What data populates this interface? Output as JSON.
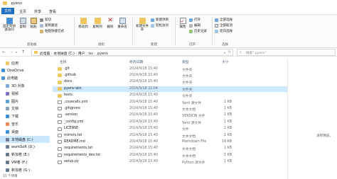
{
  "window": {
    "title": ".pyenv"
  },
  "ribbon": {
    "tabs": [
      "文件",
      "主页",
      "共享",
      "查看"
    ],
    "clipboard": {
      "pin": "固定到快速访问",
      "copy": "复制",
      "paste": "粘贴",
      "cut": "剪切",
      "copy_path": "复制路径",
      "paste_shortcut": "粘贴快捷方式",
      "label": "剪贴板"
    },
    "organize": {
      "move_to": "移动到",
      "copy_to": "复制到",
      "delete": "删除",
      "rename": "重命名",
      "label": "组织"
    },
    "new": {
      "new_folder": "新建文件夹",
      "new_item": "新建项目",
      "easy_access": "轻松访问",
      "label": "新建"
    },
    "open": {
      "properties": "属性",
      "open": "打开",
      "edit": "编辑",
      "history": "历史记录",
      "label": "打开"
    },
    "select": {
      "select_all": "全部选择",
      "select_none": "全部取消",
      "invert": "反向选择",
      "label": "选择"
    }
  },
  "address": {
    "path": [
      "此电脑",
      "本地磁盘 (C:)",
      "用户",
      "lss",
      ".pyenv"
    ],
    "search_placeholder": "搜索\".pyenv\""
  },
  "nav": [
    {
      "label": "应用"
    },
    {
      "label": "OneDrive"
    },
    {
      "label": "此电脑"
    },
    {
      "label": "3D 对象"
    },
    {
      "label": "视频"
    },
    {
      "label": "图片"
    },
    {
      "label": "文档"
    },
    {
      "label": "下载"
    },
    {
      "label": "音乐"
    },
    {
      "label": "桌面"
    },
    {
      "label": "本地磁盘 (C:)"
    },
    {
      "label": "workSoft (D:)"
    },
    {
      "label": "新加卷 (E:)"
    },
    {
      "label": "VM卷 (F:)"
    },
    {
      "label": "新加卷 (G:)"
    }
  ],
  "columns": {
    "name": "名称",
    "date": "修改日期",
    "type": "类型",
    "size": "大小"
  },
  "files": [
    {
      "name": ".git",
      "date": "2024/9/18 15:40",
      "type": "文件夹",
      "size": "",
      "kind": "folder"
    },
    {
      "name": ".github",
      "date": "2024/9/18 15:40",
      "type": "文件夹",
      "size": "",
      "kind": "folder"
    },
    {
      "name": "docs",
      "date": "2024/9/18 15:40",
      "type": "文件夹",
      "size": "",
      "kind": "folder"
    },
    {
      "name": "pyenv-win",
      "date": "2024/9/18 21:04",
      "type": "文件夹",
      "size": "",
      "kind": "folder",
      "selected": true
    },
    {
      "name": "tests",
      "date": "2024/9/18 15:40",
      "type": "文件夹",
      "size": "",
      "kind": "folder"
    },
    {
      "name": ".coveralls.yml",
      "date": "2024/9/18 15:40",
      "type": "Yaml 源文件",
      "size": "1 KB",
      "kind": "doc"
    },
    {
      "name": ".gitignore",
      "date": "2024/9/18 15:40",
      "type": "文本文档",
      "size": "1 KB",
      "kind": "doc"
    },
    {
      "name": ".version",
      "date": "2024/9/18 15:40",
      "type": "VERSION 文件",
      "size": "1 KB",
      "kind": "doc"
    },
    {
      "name": "_config.yml",
      "date": "2024/9/18 15:40",
      "type": "Yaml 源文件",
      "size": "1 KB",
      "kind": "doc"
    },
    {
      "name": "LICENSE",
      "date": "2024/9/18 15:40",
      "type": "文件",
      "size": "2 KB",
      "kind": "doc"
    },
    {
      "name": "mirrors.txt",
      "date": "2024/9/18 15:40",
      "type": "文本文档",
      "size": "1 KB",
      "kind": "doc"
    },
    {
      "name": "README.md",
      "date": "2024/9/18 15:40",
      "type": "Markdown File",
      "size": "18 KB",
      "kind": "doc"
    },
    {
      "name": "requirements.txt",
      "date": "2024/9/18 15:40",
      "type": "文本文档",
      "size": "1 KB",
      "kind": "doc"
    },
    {
      "name": "requirements_dev.txt",
      "date": "2024/9/18 15:40",
      "type": "文本文档",
      "size": "1 KB",
      "kind": "doc"
    },
    {
      "name": "setup.py",
      "date": "2024/9/18 15:40",
      "type": "Python 源文件",
      "size": "1 KB",
      "kind": "doc"
    }
  ],
  "preview": {
    "text": "没有预览。"
  },
  "status": {
    "count": "15 个项目"
  }
}
